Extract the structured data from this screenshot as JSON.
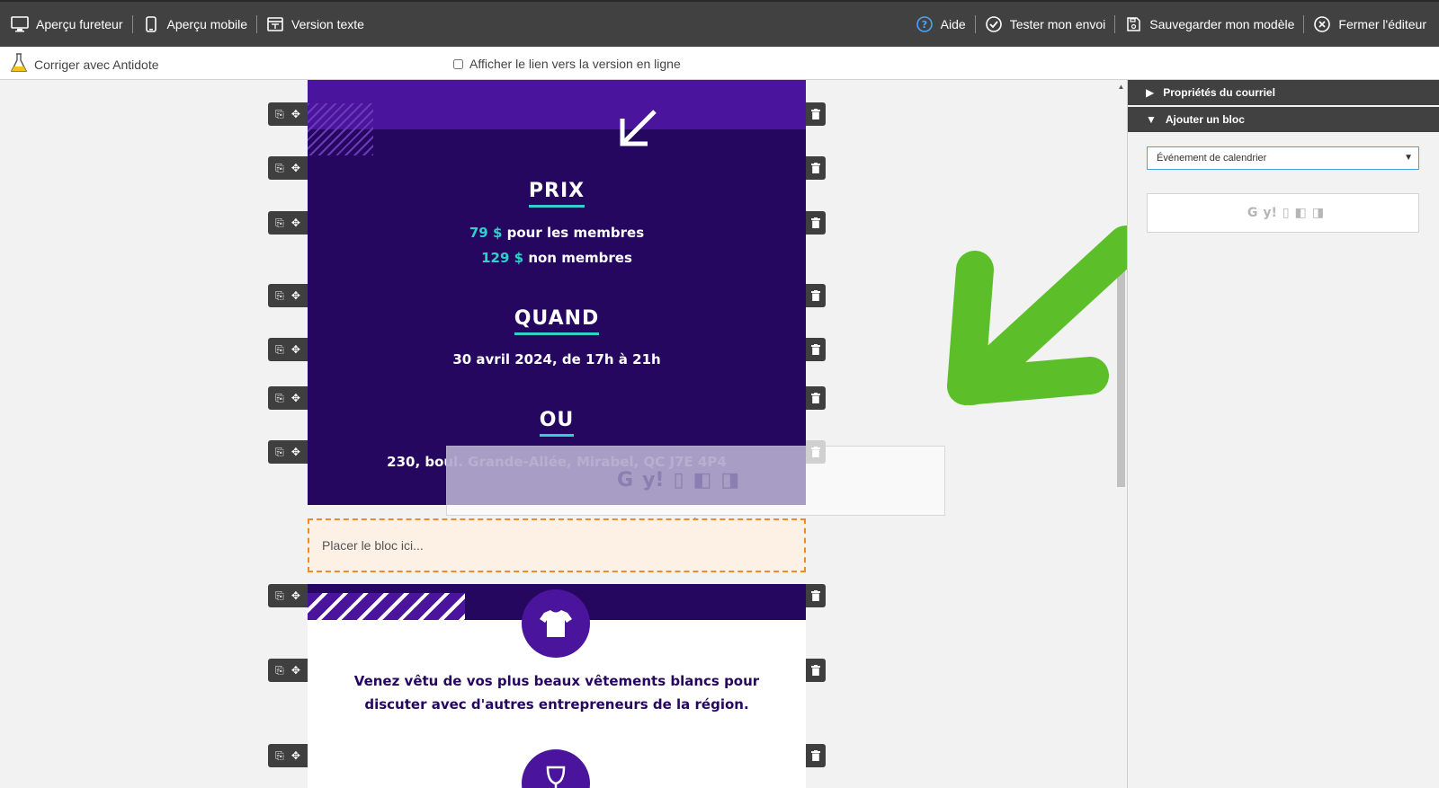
{
  "toolbar": {
    "left": [
      {
        "label": "Aperçu fureteur",
        "icon": "monitor-icon"
      },
      {
        "label": "Aperçu mobile",
        "icon": "mobile-icon"
      },
      {
        "label": "Version texte",
        "icon": "text-version-icon"
      }
    ],
    "right": [
      {
        "label": "Aide",
        "icon": "help-icon"
      },
      {
        "label": "Tester mon envoi",
        "icon": "check-circle-icon"
      },
      {
        "label": "Sauvegarder mon modèle",
        "icon": "save-icon"
      },
      {
        "label": "Fermer l'éditeur",
        "icon": "close-circle-icon"
      }
    ]
  },
  "subbar": {
    "antidote_label": "Corriger avec Antidote",
    "online_link_label": "Afficher le lien vers la version en ligne",
    "online_link_checked": false
  },
  "email": {
    "prix_heading": "PRIX",
    "price_members_amount": "79 $",
    "price_members_text": " pour les membres",
    "price_nonmembers_amount": "129 $",
    "price_nonmembers_text": " non membres",
    "quand_heading": "QUAND",
    "date_text": "30 avril 2024, de 17h à 21h",
    "ou_heading": "OU",
    "address_text": "230, boul. Grande-Allée, Mirabel, QC J7E 4P4",
    "dropzone_text": "Placer le bloc ici...",
    "dress_text": "Venez vêtu de vos plus beaux vêtements blancs pour discuter avec d'autres entrepreneurs de la région."
  },
  "panel": {
    "properties_label": "Propriétés du courriel",
    "add_block_label": "Ajouter un bloc",
    "block_select_value": "Événement de calendrier",
    "calendar_icons": [
      "apple-icon",
      "google-icon",
      "yahoo-icon",
      "office-icon",
      "outlook-icon",
      "outlook-web-icon"
    ]
  },
  "colors": {
    "toolbar_bg": "#414141",
    "email_purple": "#260760",
    "accent_purple": "#4a159c",
    "teal": "#2fd1c9",
    "dropzone_border": "#f08a24",
    "arrow_green": "#5cbf2a"
  }
}
